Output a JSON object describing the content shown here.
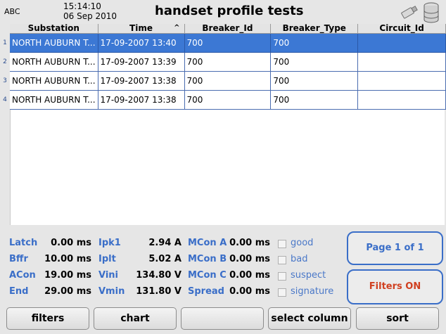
{
  "header": {
    "brand": "ABC",
    "time": "15:14:10",
    "date": "06 Sep 2010",
    "title": "handset profile tests"
  },
  "table": {
    "columns": [
      "Substation",
      "Time",
      "Breaker_Id",
      "Breaker_Type",
      "Circuit_Id"
    ],
    "sort_indicator": "^",
    "row_numbers": [
      "1",
      "2",
      "3",
      "4"
    ],
    "rows": [
      [
        "NORTH AUBURN T...",
        "17-09-2007 13:40",
        "700",
        "700",
        ""
      ],
      [
        "NORTH AUBURN T...",
        "17-09-2007 13:39",
        "700",
        "700",
        ""
      ],
      [
        "NORTH AUBURN T...",
        "17-09-2007 13:38",
        "700",
        "700",
        ""
      ],
      [
        "NORTH AUBURN T...",
        "17-09-2007 13:38",
        "700",
        "700",
        ""
      ]
    ]
  },
  "stats": {
    "col1": [
      {
        "label": "Latch",
        "value": "0.00 ms"
      },
      {
        "label": "Bffr",
        "value": "10.00 ms"
      },
      {
        "label": "ACon",
        "value": "19.00 ms"
      },
      {
        "label": "End",
        "value": "29.00 ms"
      }
    ],
    "col2": [
      {
        "label": "Ipk1",
        "value": "2.94 A"
      },
      {
        "label": "Iplt",
        "value": "5.02 A"
      },
      {
        "label": "Vini",
        "value": "134.80 V"
      },
      {
        "label": "Vmin",
        "value": "131.80 V"
      }
    ],
    "col3": [
      {
        "label": "MCon A",
        "value": "0.00 ms"
      },
      {
        "label": "MCon B",
        "value": "0.00 ms"
      },
      {
        "label": "MCon C",
        "value": "0.00 ms"
      },
      {
        "label": "Spread",
        "value": "0.00 ms"
      }
    ],
    "checks": [
      "good",
      "bad",
      "suspect",
      "signature"
    ]
  },
  "side": {
    "page": "Page 1 of 1",
    "filters_status": "Filters ON"
  },
  "buttons": {
    "filters": "filters",
    "chart": "chart",
    "blank": "",
    "select_column": "select column",
    "sort": "sort"
  },
  "colors": {
    "accent": "#3a6ec8",
    "selected_row": "#3c78d4",
    "filters_on": "#d04020"
  }
}
